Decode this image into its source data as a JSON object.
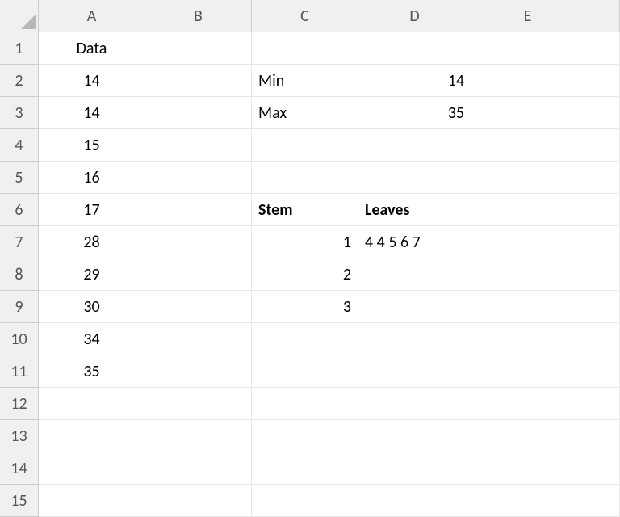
{
  "columns": [
    "A",
    "B",
    "C",
    "D",
    "E"
  ],
  "rows": 15,
  "cells": {
    "A1": {
      "value": "Data",
      "align": "center"
    },
    "A2": {
      "value": "14",
      "align": "center"
    },
    "A3": {
      "value": "14",
      "align": "center"
    },
    "A4": {
      "value": "15",
      "align": "center"
    },
    "A5": {
      "value": "16",
      "align": "center"
    },
    "A6": {
      "value": "17",
      "align": "center"
    },
    "A7": {
      "value": "28",
      "align": "center"
    },
    "A8": {
      "value": "29",
      "align": "center"
    },
    "A9": {
      "value": "30",
      "align": "center"
    },
    "A10": {
      "value": "34",
      "align": "center"
    },
    "A11": {
      "value": "35",
      "align": "center"
    },
    "C2": {
      "value": "Min",
      "align": "left"
    },
    "C3": {
      "value": "Max",
      "align": "left"
    },
    "D2": {
      "value": "14",
      "align": "right"
    },
    "D3": {
      "value": "35",
      "align": "right"
    },
    "C6": {
      "value": "Stem",
      "align": "left",
      "bold": true
    },
    "D6": {
      "value": "Leaves",
      "align": "left",
      "bold": true
    },
    "C7": {
      "value": "1",
      "align": "right"
    },
    "C8": {
      "value": "2",
      "align": "right"
    },
    "C9": {
      "value": "3",
      "align": "right"
    },
    "D7": {
      "value": "4 4 5 6 7",
      "align": "left"
    }
  }
}
